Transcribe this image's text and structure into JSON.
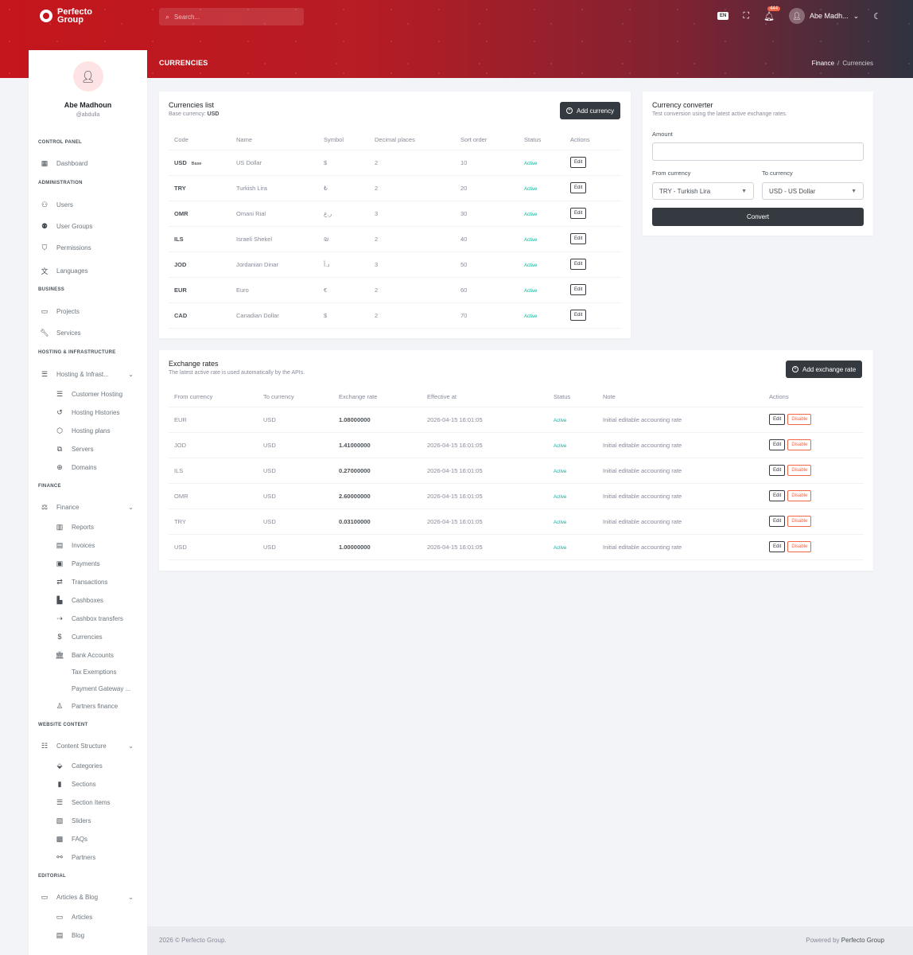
{
  "brand": {
    "name": "Perfecto Group",
    "name_line1": "Perfecto",
    "name_line2": "Group"
  },
  "header": {
    "search_placeholder": "Search...",
    "language": "EN",
    "notification_count": "444",
    "user_name": "Abe Madh...",
    "page_title": "CURRENCIES",
    "breadcrumb": [
      "Finance",
      "Currencies"
    ]
  },
  "profile": {
    "name": "Abe Madhoun",
    "handle": "@abdulla"
  },
  "sidebar": {
    "sections": {
      "control_panel": "CONTROL PANEL",
      "administration": "ADMINISTRATION",
      "business": "BUSINESS",
      "hosting": "HOSTING & INFRASTRUCTURE",
      "finance": "FINANCE",
      "website": "WEBSITE CONTENT",
      "editorial": "EDITORIAL"
    },
    "items": {
      "dashboard": "Dashboard",
      "users": "Users",
      "user_groups": "User Groups",
      "permissions": "Permissions",
      "languages": "Languages",
      "projects": "Projects",
      "services": "Services",
      "hosting_infra": "Hosting & Infrast...",
      "customer_hosting": "Customer Hosting",
      "hosting_histories": "Hosting Histories",
      "hosting_plans": "Hosting plans",
      "servers": "Servers",
      "domains": "Domains",
      "finance": "Finance",
      "reports": "Reports",
      "invoices": "Invoices",
      "payments": "Payments",
      "transactions": "Transactions",
      "cashboxes": "Cashboxes",
      "cashbox_transfers": "Cashbox transfers",
      "currencies": "Currencies",
      "bank_accounts": "Bank Accounts",
      "tax_exemptions": "Tax Exemptions",
      "payment_gateway": "Payment Gateway ...",
      "partners_finance": "Partners finance",
      "content_structure": "Content Structure",
      "categories": "Categories",
      "sections": "Sections",
      "section_items": "Section Items",
      "sliders": "Sliders",
      "faqs": "FAQs",
      "partners": "Partners",
      "articles_blog": "Articles & Blog",
      "articles": "Articles",
      "blog": "Blog"
    }
  },
  "currencies_card": {
    "title": "Currencies list",
    "base_label": "Base currency:",
    "base_value": "USD",
    "add_label": "Add currency",
    "columns": [
      "Code",
      "Name",
      "Symbol",
      "Decimal places",
      "Sort order",
      "Status",
      "Actions"
    ],
    "base_tag": "Base",
    "edit_label": "Edit",
    "rows": [
      {
        "code": "USD",
        "name": "US Dollar",
        "symbol": "$",
        "decimals": "2",
        "sort": "10",
        "status": "Active"
      },
      {
        "code": "TRY",
        "name": "Turkish Lira",
        "symbol": "₺",
        "decimals": "2",
        "sort": "20",
        "status": "Active"
      },
      {
        "code": "OMR",
        "name": "Omani Rial",
        "symbol": "ر.ع",
        "decimals": "3",
        "sort": "30",
        "status": "Active"
      },
      {
        "code": "ILS",
        "name": "Israeli Shekel",
        "symbol": "₪",
        "decimals": "2",
        "sort": "40",
        "status": "Active"
      },
      {
        "code": "JOD",
        "name": "Jordanian Dinar",
        "symbol": "د.أ",
        "decimals": "3",
        "sort": "50",
        "status": "Active"
      },
      {
        "code": "EUR",
        "name": "Euro",
        "symbol": "€",
        "decimals": "2",
        "sort": "60",
        "status": "Active"
      },
      {
        "code": "CAD",
        "name": "Canadian Dollar",
        "symbol": "$",
        "decimals": "2",
        "sort": "70",
        "status": "Active"
      }
    ]
  },
  "converter": {
    "title": "Currency converter",
    "subtitle": "Test conversion using the latest active exchange rates.",
    "amount_label": "Amount",
    "amount_value": "",
    "from_label": "From currency",
    "from_value": "TRY - Turkish Lira",
    "to_label": "To currency",
    "to_value": "USD - US Dollar",
    "convert_label": "Convert"
  },
  "rates_card": {
    "title": "Exchange rates",
    "subtitle": "The latest active rate is used automatically by the APIs.",
    "add_label": "Add exchange rate",
    "columns": [
      "From currency",
      "To currency",
      "Exchange rate",
      "Effective at",
      "Status",
      "Note",
      "Actions"
    ],
    "edit_label": "Edit",
    "disable_label": "Disable",
    "rows": [
      {
        "from": "EUR",
        "to": "USD",
        "rate": "1.08000000",
        "effective": "2026-04-15 16:01:05",
        "status": "Active",
        "note": "Initial editable accounting rate"
      },
      {
        "from": "JOD",
        "to": "USD",
        "rate": "1.41000000",
        "effective": "2026-04-15 16:01:05",
        "status": "Active",
        "note": "Initial editable accounting rate"
      },
      {
        "from": "ILS",
        "to": "USD",
        "rate": "0.27000000",
        "effective": "2026-04-15 16:01:05",
        "status": "Active",
        "note": "Initial editable accounting rate"
      },
      {
        "from": "OMR",
        "to": "USD",
        "rate": "2.60000000",
        "effective": "2026-04-15 16:01:05",
        "status": "Active",
        "note": "Initial editable accounting rate"
      },
      {
        "from": "TRY",
        "to": "USD",
        "rate": "0.03100000",
        "effective": "2026-04-15 16:01:05",
        "status": "Active",
        "note": "Initial editable accounting rate"
      },
      {
        "from": "USD",
        "to": "USD",
        "rate": "1.00000000",
        "effective": "2026-04-15 16:01:05",
        "status": "Active",
        "note": "Initial editable accounting rate"
      }
    ]
  },
  "footer": {
    "copyright": "2026 © Perfecto Group.",
    "powered_prefix": "Powered by",
    "powered_brand": "Perfecto Group"
  },
  "colors": {
    "brand_red": "#c4161c",
    "dark": "#343a40",
    "success": "#0ab39c",
    "danger": "#f06548"
  }
}
